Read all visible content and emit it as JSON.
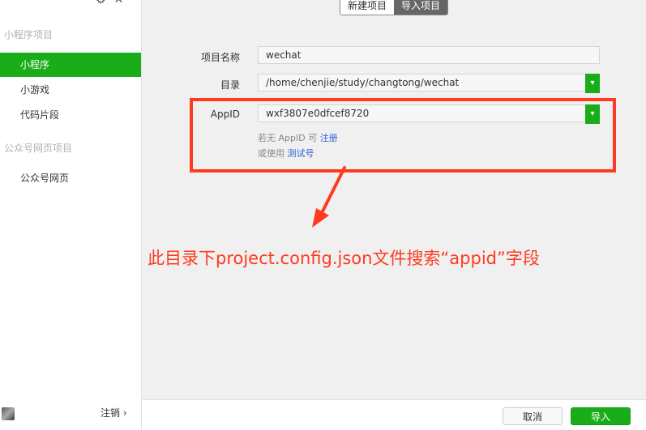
{
  "sidebar": {
    "section_miniprogram": "小程序项目",
    "items_miniprogram": [
      {
        "label": "小程序",
        "active": true
      },
      {
        "label": "小游戏",
        "active": false
      },
      {
        "label": "代码片段",
        "active": false
      }
    ],
    "section_official": "公众号网页项目",
    "items_official": [
      {
        "label": "公众号网页",
        "active": false
      }
    ],
    "logout_label": "注销",
    "logout_chevron": "›"
  },
  "tabs": [
    {
      "label": "新建项目",
      "active": false
    },
    {
      "label": "导入项目",
      "active": true
    }
  ],
  "form": {
    "name_label": "项目名称",
    "name_value": "wechat",
    "dir_label": "目录",
    "dir_value": "/home/chenjie/study/changtong/wechat",
    "appid_label": "AppID",
    "appid_value": "wxf3807e0dfcef8720",
    "hint1_prefix": "若无 AppID 可",
    "hint1_link": "注册",
    "hint2_prefix": "或使用",
    "hint2_link": "测试号"
  },
  "annotation": "此目录下project.config.json文件搜索“appid”字段",
  "footer": {
    "cancel_label": "取消",
    "import_label": "导入"
  },
  "colors": {
    "accent": "#1aad19",
    "annotation": "#ff3b1f",
    "link": "#2f5fd5"
  },
  "icons": [
    "gear-icon",
    "close-icon",
    "chevron-down-icon",
    "avatar",
    "arrow-annotation-icon"
  ]
}
